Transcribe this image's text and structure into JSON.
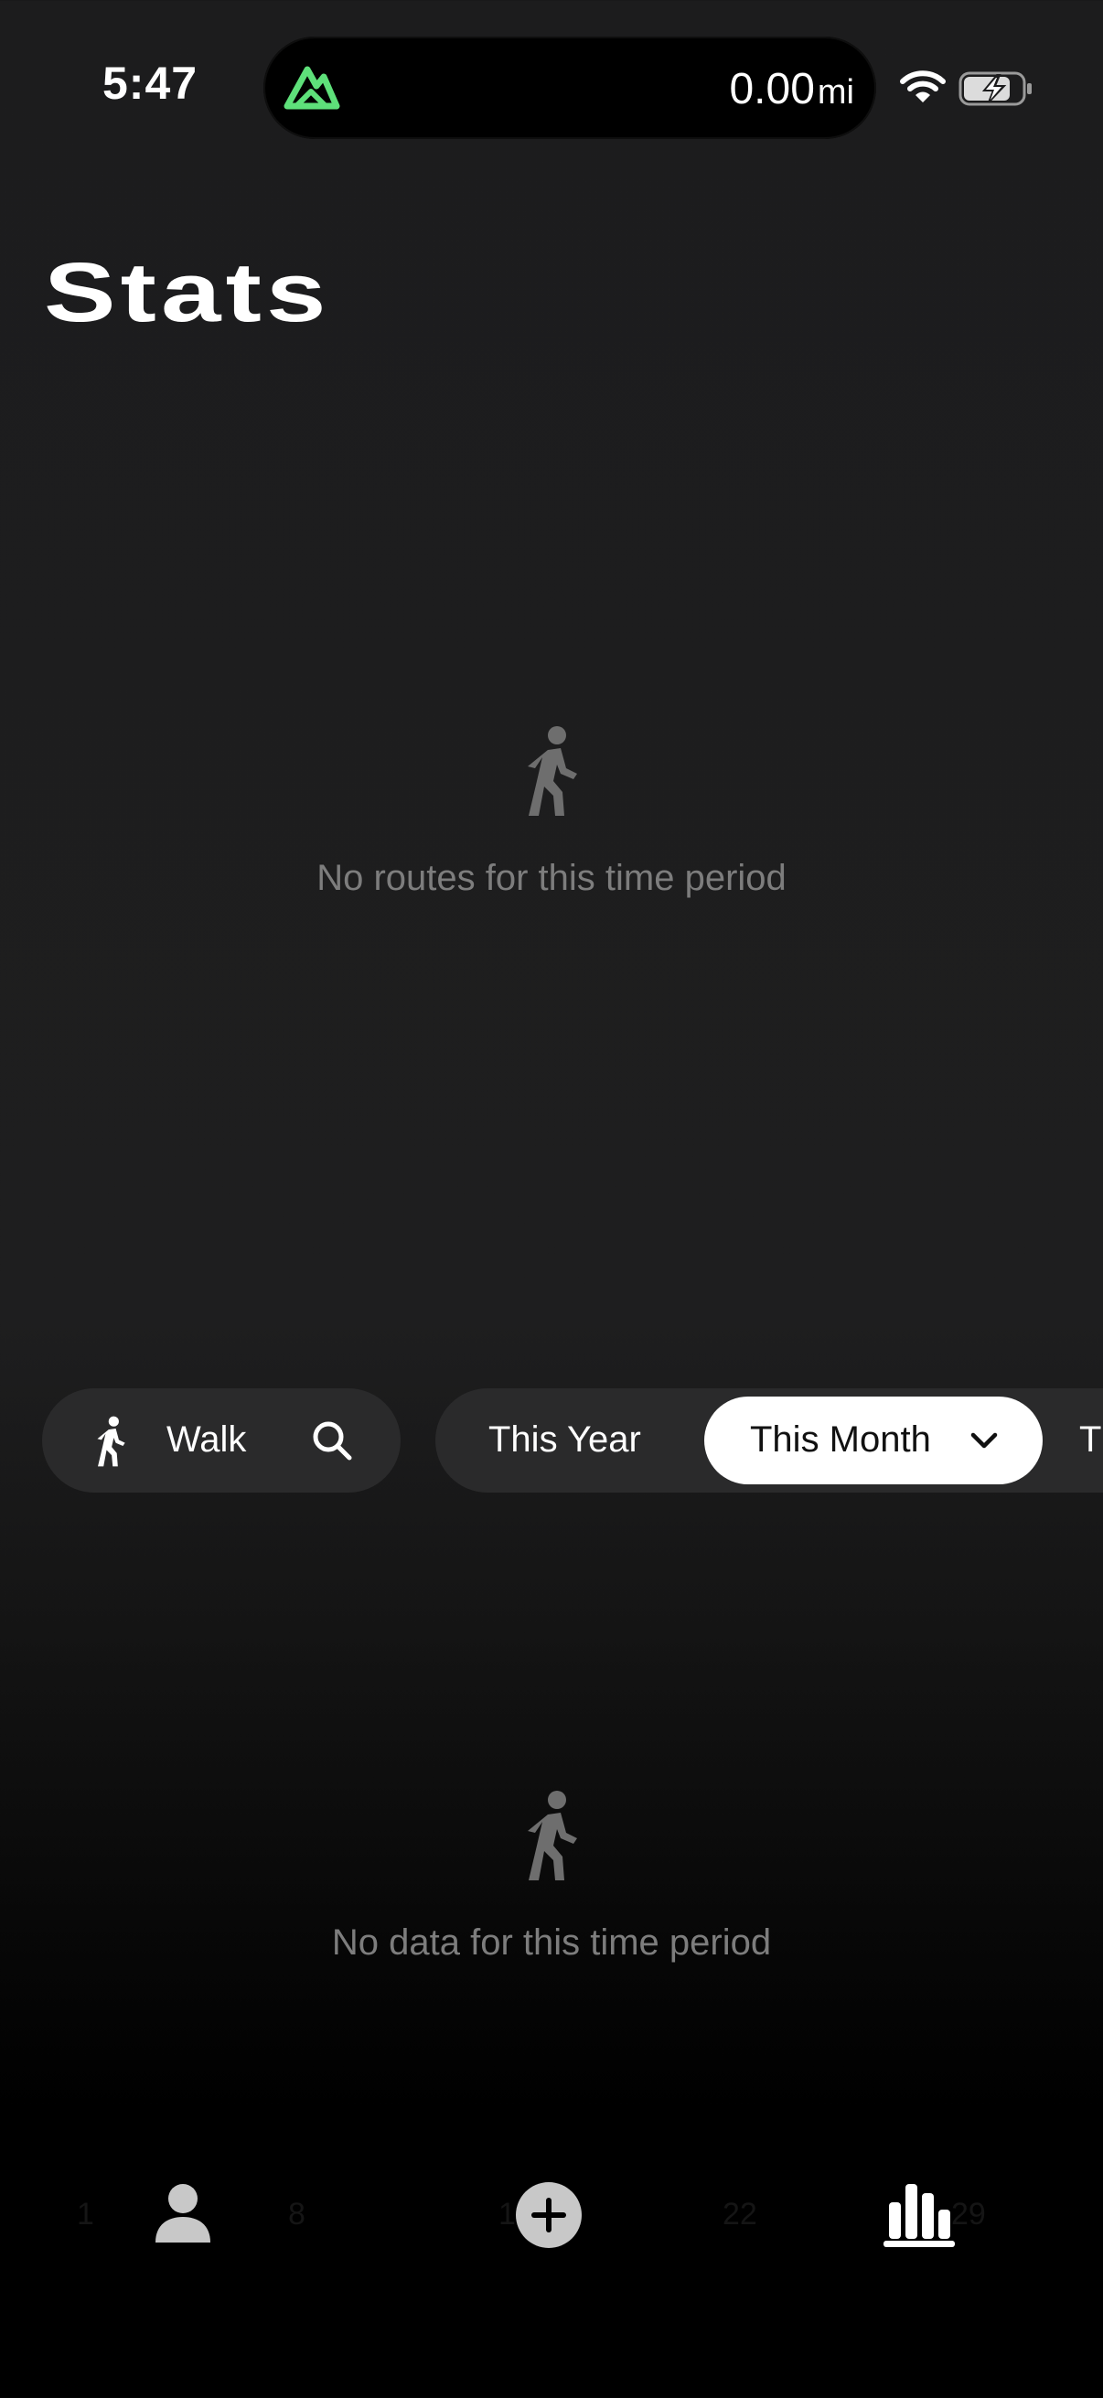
{
  "status_bar": {
    "time": "5:47",
    "distance_value": "0.00",
    "distance_unit": "mi"
  },
  "page": {
    "title": "Stats"
  },
  "routes_section": {
    "empty_message": "No routes for this time period",
    "icon": "walking-person-icon"
  },
  "filters": {
    "activity_label": "Walk",
    "periods": [
      "This Year",
      "This Month",
      "T"
    ],
    "selected_period": "This Month"
  },
  "data_section": {
    "empty_message": "No data for this time period",
    "icon": "walking-person-icon"
  },
  "tab_bar": {
    "faint_day_labels": [
      "1",
      "8",
      "15",
      "22",
      "29"
    ],
    "items": [
      "profile-icon",
      "add-icon",
      "stats-icon"
    ],
    "active": "stats-icon"
  },
  "colors": {
    "accent": "#5ee07a",
    "pill_background": "#2a2a2b",
    "selected_pill": "#ffffff",
    "muted_text": "#7d7d7d"
  }
}
